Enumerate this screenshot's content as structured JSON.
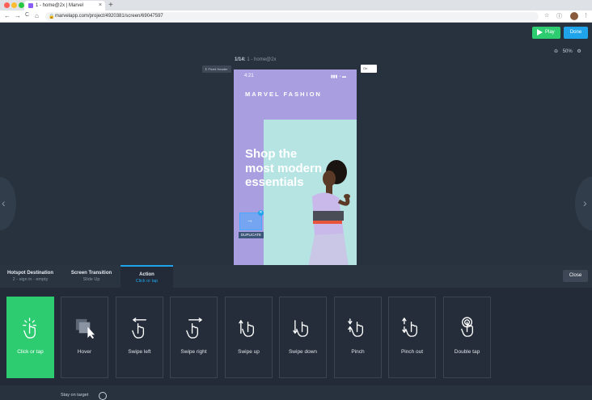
{
  "browser": {
    "tab_title": "1 - home@2x | Marvel",
    "tab_close": "×",
    "new_tab": "+",
    "url": "marvelapp.com/project/4920381/screen/69047597",
    "nav_back": "←",
    "nav_forward": "→",
    "nav_reload": "C",
    "nav_home": "⌂",
    "lock": "🔒",
    "star": "☆",
    "info": "ⓘ",
    "menu": "⋮"
  },
  "toolbar": {
    "play_label": "Play",
    "done_label": "Done",
    "zoom": "50%",
    "zoom_minus": "⊖",
    "zoom_plus": "⚙"
  },
  "canvas": {
    "fixed_header": "⇕ Fixed Header",
    "screen_index": "1/14:",
    "screen_name": " 1 - home@2x",
    "on_badge": "On",
    "prev": "‹",
    "next": "›"
  },
  "phone": {
    "time": "4:21",
    "status": "▮▮▮ ◔ ▬",
    "brand": "MARVEL FASHION",
    "headline": "Shop the most modern essentials",
    "hotspot_arrow": "→",
    "hotspot_close": "✕",
    "duplicate_label": "DUPLICATE"
  },
  "panel": {
    "tabs": [
      {
        "title": "Hotspot Destination",
        "sub": "2 - sign in - empty"
      },
      {
        "title": "Screen Transition",
        "sub": "Slide Up"
      },
      {
        "title": "Action",
        "sub": "Click or tap"
      }
    ],
    "close_label": "Close",
    "gestures": [
      {
        "label": "Click or tap",
        "icon": "tap-icon"
      },
      {
        "label": "Hover",
        "icon": "hover-icon"
      },
      {
        "label": "Swipe left",
        "icon": "swipe-left-icon"
      },
      {
        "label": "Swipe right",
        "icon": "swipe-right-icon"
      },
      {
        "label": "Swipe up",
        "icon": "swipe-up-icon"
      },
      {
        "label": "Swipe down",
        "icon": "swipe-down-icon"
      },
      {
        "label": "Pinch",
        "icon": "pinch-icon"
      },
      {
        "label": "Pinch out",
        "icon": "pinch-out-icon"
      },
      {
        "label": "Double tap",
        "icon": "double-tap-icon"
      }
    ],
    "stay_on_target": "Stay on target"
  },
  "colors": {
    "accent": "#1fa4ec",
    "play": "#2ecc71",
    "selected": "#2ecc71",
    "phone_bg": "#a99fe0",
    "mint": "#b6e4e3"
  }
}
